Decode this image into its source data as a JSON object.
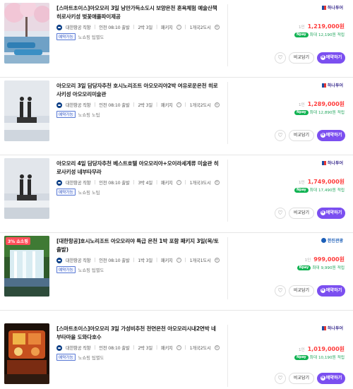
{
  "colors": {
    "accent_purple": "#7b4ff0",
    "price_red": "#ff3d3d",
    "points_green": "#12b353"
  },
  "common": {
    "compare_label": "비교담기",
    "reserve_label": "예약하기",
    "reserve_icon": "N",
    "heart_icon": "heart-icon",
    "per_label": "1인",
    "npay_label": "Npay",
    "max_label": "최대",
    "earn_label": "적립"
  },
  "items": [
    {
      "title": "[스마트초이스]아오모리 3일 낭만가득소도시 보양온천 혼욕체험 예술산책 히로사키성 벚꽃애플파이제공",
      "airline": "대한항공 직항",
      "depart": "인천 08:10 출발",
      "duration": "2박 3일",
      "type": "패키지",
      "cities": "1개국2도시",
      "tag": "예약가능",
      "extras": "노쇼핑  팁별도",
      "brand": "하나투어",
      "price": "1,219,000원",
      "points": "12,190원",
      "new_badge": ""
    },
    {
      "title": "아오모리 3일 담당자추천 호시노리조트 아오모리야2박 여유로운온천 히로사키성 아오모리미술관",
      "airline": "대한항공 직항",
      "depart": "인천 08:10 출발",
      "duration": "2박 3일",
      "type": "패키지",
      "cities": "1개국2도시",
      "tag": "예약가능",
      "extras": "노쇼핑  노팁",
      "brand": "하나투어",
      "price": "1,289,000원",
      "points": "12,890원",
      "new_badge": ""
    },
    {
      "title": "아오모리 4일 담당자추천 베스트호텔 아오모리야+오이라세계류 미술관 히로사키성 네부타무라",
      "airline": "대한항공 직항",
      "depart": "인천 08:10 출발",
      "duration": "3박 4일",
      "type": "패키지",
      "cities": "1개국3도시",
      "tag": "예약가능",
      "extras": "노쇼핑  노팁",
      "brand": "하나투어",
      "price": "1,749,000원",
      "points": "17,490원",
      "new_badge": ""
    },
    {
      "title": "[대한항공]호시노리조트 아오모리야 특급 온천 1박 포함 패키지 3일(목/토 출발)",
      "airline": "대한항공 직항",
      "depart": "인천 08:10 출발",
      "duration": "1박 3일",
      "type": "패키지",
      "cities": "1개국1도시",
      "tag": "예약가능",
      "extras": "노쇼핑  팁별도",
      "brand": "한진관광",
      "price": "999,000원",
      "points": "9,990원",
      "new_badge": "3% 쇼소핑"
    },
    {
      "title": "[스마트초이스]아오모리 3일 가성비추천 천연온천 아오모리시내2연박 네부타마을 도와다호수",
      "airline": "대한항공 직항",
      "depart": "인천 08:10 출발",
      "duration": "2박 3일",
      "type": "패키지",
      "cities": "1개국2도시",
      "tag": "예약가능",
      "extras": "노쇼핑  팁별도",
      "brand": "하나투어",
      "price": "1,019,000원",
      "points": "10,190원",
      "new_badge": ""
    }
  ]
}
